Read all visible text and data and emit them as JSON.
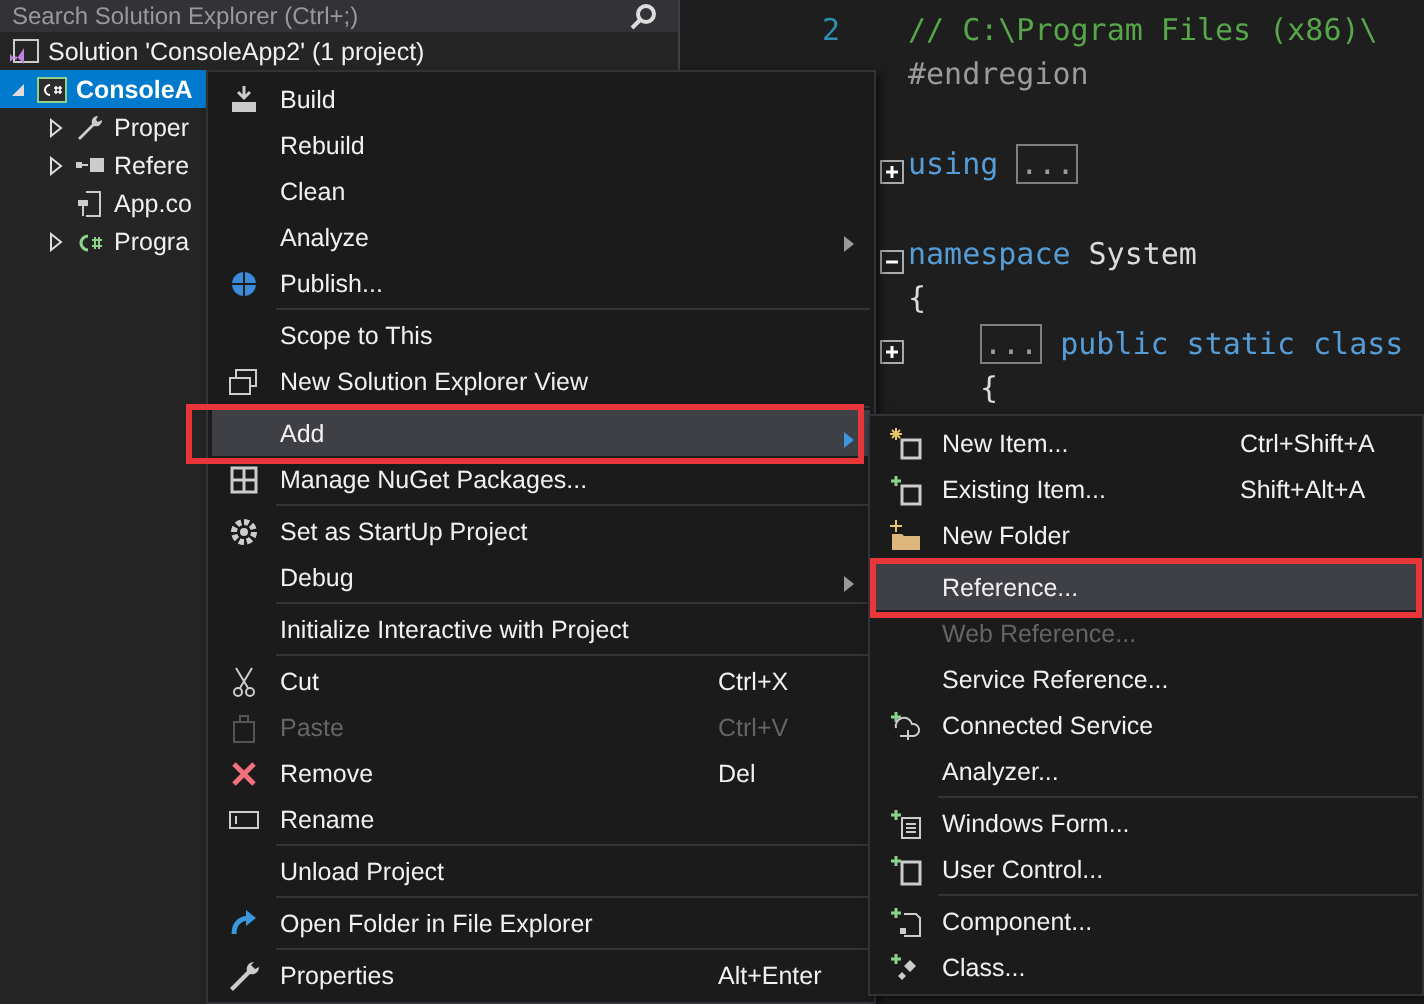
{
  "solution_explorer": {
    "search": {
      "placeholder": "Search Solution Explorer (Ctrl+;)"
    },
    "tree": [
      {
        "label": "Solution 'ConsoleApp2' (1 project)",
        "selected": false,
        "children": [
          {
            "label": "ConsoleA",
            "expanded": true,
            "selected": true,
            "children": [
              {
                "label": "Proper",
                "expanded": false,
                "selected": false,
                "has_children": true
              },
              {
                "label": "Refere",
                "expanded": false,
                "selected": false,
                "has_children": true
              },
              {
                "label": "App.co",
                "selected": false,
                "has_children": false
              },
              {
                "label": "Progra",
                "expanded": false,
                "selected": false,
                "has_children": true
              }
            ]
          }
        ]
      }
    ]
  },
  "editor": {
    "line_numbers": [
      "2"
    ],
    "lines": [
      {
        "kind": "code",
        "tokens": [
          {
            "kind": "comment",
            "text": "// C:\\Program Files (x86)\\"
          }
        ]
      },
      {
        "kind": "code",
        "tokens": [
          {
            "kind": "directive",
            "text": "#endregion"
          }
        ]
      },
      {
        "kind": "blank"
      },
      {
        "kind": "code",
        "outline": {
          "expanded": false
        },
        "tokens": [
          {
            "kind": "keyword",
            "text": "using"
          },
          {
            "kind": "collapsed",
            "text": "..."
          }
        ]
      },
      {
        "kind": "blank"
      },
      {
        "kind": "code",
        "outline": {
          "expanded": true
        },
        "tokens": [
          {
            "kind": "keyword",
            "text": "namespace"
          },
          {
            "kind": "plain",
            "text": "System"
          }
        ]
      },
      {
        "kind": "code",
        "tokens": [
          {
            "kind": "plain",
            "text": "{"
          }
        ]
      },
      {
        "kind": "code",
        "outline": {
          "expanded": false
        },
        "tokens": [
          {
            "kind": "indent"
          },
          {
            "kind": "collapsed",
            "text": "..."
          },
          {
            "kind": "keyword",
            "text": "public static class"
          }
        ]
      },
      {
        "kind": "code",
        "tokens": [
          {
            "kind": "indent"
          },
          {
            "kind": "plain",
            "text": "{"
          }
        ]
      }
    ]
  },
  "context_menu": {
    "items": [
      {
        "kind": "item",
        "label": "Build",
        "disabled": false,
        "selected": false
      },
      {
        "kind": "item",
        "label": "Rebuild",
        "disabled": false,
        "selected": false
      },
      {
        "kind": "item",
        "label": "Clean",
        "disabled": false,
        "selected": false
      },
      {
        "kind": "item",
        "label": "Analyze",
        "submenu": true,
        "disabled": false,
        "selected": false
      },
      {
        "kind": "item",
        "label": "Publish...",
        "disabled": false,
        "selected": false
      },
      {
        "kind": "separator"
      },
      {
        "kind": "item",
        "label": "Scope to This",
        "disabled": false,
        "selected": false
      },
      {
        "kind": "item",
        "label": "New Solution Explorer View",
        "disabled": false,
        "selected": false
      },
      {
        "kind": "separator"
      },
      {
        "kind": "item",
        "label": "Add",
        "submenu": true,
        "disabled": false,
        "selected": true,
        "annotated": true
      },
      {
        "kind": "item",
        "label": "Manage NuGet Packages...",
        "disabled": false,
        "selected": false
      },
      {
        "kind": "separator"
      },
      {
        "kind": "item",
        "label": "Set as StartUp Project",
        "disabled": false,
        "selected": false
      },
      {
        "kind": "item",
        "label": "Debug",
        "submenu": true,
        "disabled": false,
        "selected": false
      },
      {
        "kind": "separator"
      },
      {
        "kind": "item",
        "label": "Initialize Interactive with Project",
        "disabled": false,
        "selected": false
      },
      {
        "kind": "separator"
      },
      {
        "kind": "item",
        "label": "Cut",
        "shortcut": "Ctrl+X",
        "disabled": false,
        "selected": false
      },
      {
        "kind": "item",
        "label": "Paste",
        "shortcut": "Ctrl+V",
        "disabled": true,
        "selected": false
      },
      {
        "kind": "item",
        "label": "Remove",
        "shortcut": "Del",
        "disabled": false,
        "selected": false
      },
      {
        "kind": "item",
        "label": "Rename",
        "disabled": false,
        "selected": false
      },
      {
        "kind": "separator"
      },
      {
        "kind": "item",
        "label": "Unload Project",
        "disabled": false,
        "selected": false
      },
      {
        "kind": "separator"
      },
      {
        "kind": "item",
        "label": "Open Folder in File Explorer",
        "disabled": false,
        "selected": false
      },
      {
        "kind": "separator"
      },
      {
        "kind": "item",
        "label": "Properties",
        "shortcut": "Alt+Enter",
        "disabled": false,
        "selected": false
      }
    ]
  },
  "add_submenu": {
    "items": [
      {
        "kind": "item",
        "label": "New Item...",
        "shortcut": "Ctrl+Shift+A",
        "disabled": false,
        "selected": false
      },
      {
        "kind": "item",
        "label": "Existing Item...",
        "shortcut": "Shift+Alt+A",
        "disabled": false,
        "selected": false
      },
      {
        "kind": "item",
        "label": "New Folder",
        "disabled": false,
        "selected": false
      },
      {
        "kind": "separator"
      },
      {
        "kind": "item",
        "label": "Reference...",
        "disabled": false,
        "selected": true,
        "annotated": true
      },
      {
        "kind": "item",
        "label": "Web Reference...",
        "disabled": true,
        "selected": false
      },
      {
        "kind": "item",
        "label": "Service Reference...",
        "disabled": false,
        "selected": false
      },
      {
        "kind": "item",
        "label": "Connected Service",
        "disabled": false,
        "selected": false
      },
      {
        "kind": "item",
        "label": "Analyzer...",
        "disabled": false,
        "selected": false
      },
      {
        "kind": "separator"
      },
      {
        "kind": "item",
        "label": "Windows Form...",
        "disabled": false,
        "selected": false
      },
      {
        "kind": "item",
        "label": "User Control...",
        "disabled": false,
        "selected": false
      },
      {
        "kind": "separator"
      },
      {
        "kind": "item",
        "label": "Component...",
        "disabled": false,
        "selected": false
      },
      {
        "kind": "item",
        "label": "Class...",
        "disabled": false,
        "selected": false
      }
    ]
  }
}
